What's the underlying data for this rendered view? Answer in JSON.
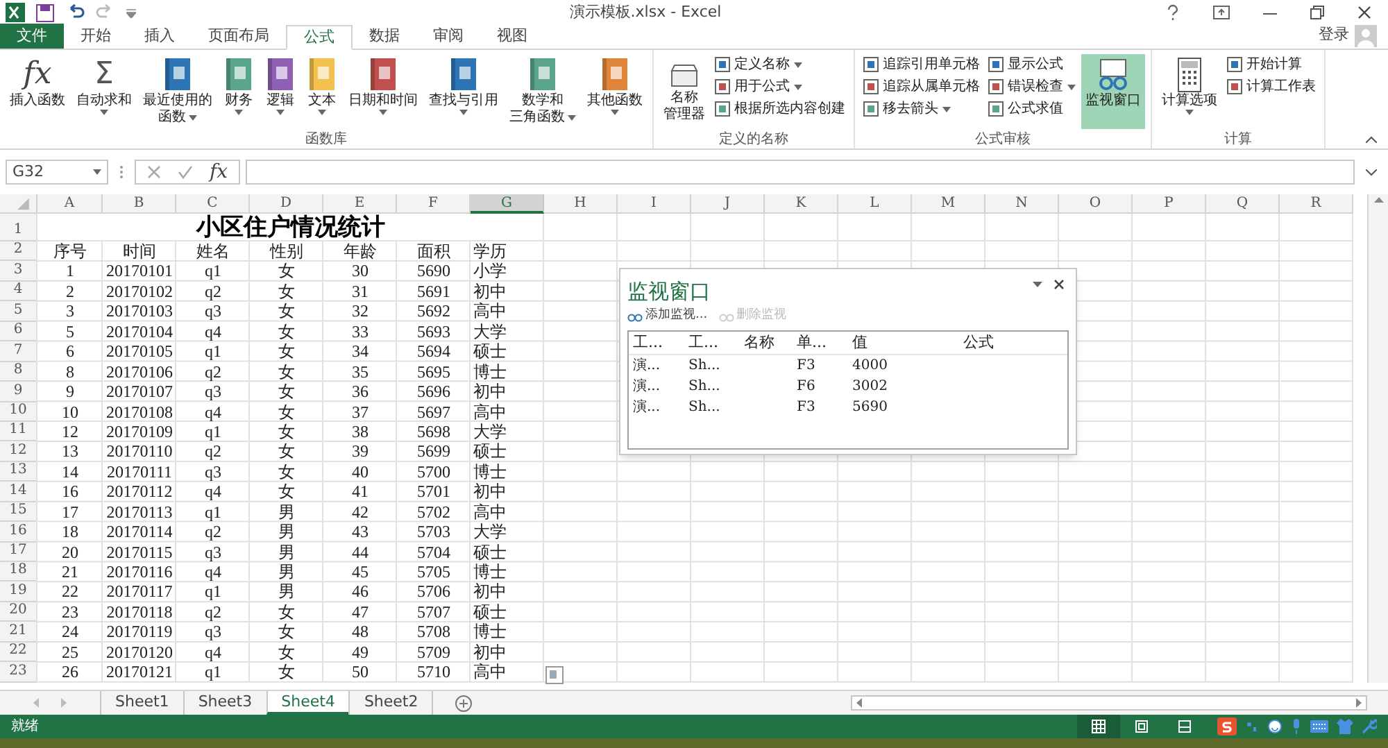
{
  "window": {
    "title": "演示模板.xlsx - Excel",
    "signin": "登录"
  },
  "tabs": [
    {
      "label": "文件",
      "kind": "file",
      "selected": false
    },
    {
      "label": "开始",
      "kind": "tab",
      "selected": false
    },
    {
      "label": "插入",
      "kind": "tab",
      "selected": false
    },
    {
      "label": "页面布局",
      "kind": "tab",
      "selected": false
    },
    {
      "label": "公式",
      "kind": "tab",
      "selected": true
    },
    {
      "label": "数据",
      "kind": "tab",
      "selected": false
    },
    {
      "label": "审阅",
      "kind": "tab",
      "selected": false
    },
    {
      "label": "视图",
      "kind": "tab",
      "selected": false
    }
  ],
  "ribbon_groups": [
    {
      "label": "函数库",
      "items": [
        {
          "kind": "large",
          "lines": [
            "插入函数"
          ],
          "glyph": "fx",
          "dropdown": false,
          "selected": false
        },
        {
          "kind": "large",
          "lines": [
            "自动求和"
          ],
          "glyph": "Σ",
          "dropdown": true,
          "selected": false
        },
        {
          "kind": "large",
          "lines": [
            "最近使用的",
            "函数"
          ],
          "dropdown": true,
          "selected": false
        },
        {
          "kind": "large",
          "lines": [
            "财务"
          ],
          "dropdown": true,
          "selected": false
        },
        {
          "kind": "large",
          "lines": [
            "逻辑"
          ],
          "dropdown": true,
          "selected": false
        },
        {
          "kind": "large",
          "lines": [
            "文本"
          ],
          "dropdown": true,
          "selected": false
        },
        {
          "kind": "large",
          "lines": [
            "日期和时间"
          ],
          "dropdown": true,
          "selected": false
        },
        {
          "kind": "large",
          "lines": [
            "查找与引用"
          ],
          "dropdown": true,
          "selected": false
        },
        {
          "kind": "large",
          "lines": [
            "数学和",
            "三角函数"
          ],
          "dropdown": true,
          "selected": false
        },
        {
          "kind": "large",
          "lines": [
            "其他函数"
          ],
          "dropdown": true,
          "selected": false
        }
      ]
    },
    {
      "label": "定义的名称",
      "items": [
        {
          "kind": "large",
          "lines": [
            "名称",
            "管理器"
          ],
          "dropdown": false,
          "selected": false
        },
        {
          "kind": "stack",
          "buttons": [
            {
              "label": "定义名称",
              "dropdown": true
            },
            {
              "label": "用于公式",
              "dropdown": true
            },
            {
              "label": "根据所选内容创建",
              "dropdown": false
            }
          ]
        }
      ]
    },
    {
      "label": "公式审核",
      "items": [
        {
          "kind": "stack",
          "buttons": [
            {
              "label": "追踪引用单元格",
              "dropdown": false
            },
            {
              "label": "追踪从属单元格",
              "dropdown": false
            },
            {
              "label": "移去箭头",
              "dropdown": true
            }
          ]
        },
        {
          "kind": "stack",
          "buttons": [
            {
              "label": "显示公式",
              "dropdown": false
            },
            {
              "label": "错误检查",
              "dropdown": true
            },
            {
              "label": "公式求值",
              "dropdown": false
            }
          ]
        },
        {
          "kind": "large",
          "lines": [
            "监视窗口"
          ],
          "dropdown": false,
          "selected": true
        }
      ]
    },
    {
      "label": "计算",
      "items": [
        {
          "kind": "large",
          "lines": [
            "计算选项"
          ],
          "dropdown": true,
          "selected": false
        },
        {
          "kind": "stack",
          "buttons": [
            {
              "label": "开始计算",
              "dropdown": false
            },
            {
              "label": "计算工作表",
              "dropdown": false
            }
          ]
        }
      ]
    }
  ],
  "formula_bar": {
    "name_box": "G32",
    "function_button": "fx"
  },
  "sheet": {
    "columns": [
      {
        "label": "A",
        "selected": false
      },
      {
        "label": "B",
        "selected": false
      },
      {
        "label": "C",
        "selected": false
      },
      {
        "label": "D",
        "selected": false
      },
      {
        "label": "E",
        "selected": false
      },
      {
        "label": "F",
        "selected": false
      },
      {
        "label": "G",
        "selected": true
      },
      {
        "label": "H",
        "selected": false
      },
      {
        "label": "I",
        "selected": false
      },
      {
        "label": "J",
        "selected": false
      },
      {
        "label": "K",
        "selected": false
      },
      {
        "label": "L",
        "selected": false
      },
      {
        "label": "M",
        "selected": false
      },
      {
        "label": "N",
        "selected": false
      },
      {
        "label": "O",
        "selected": false
      },
      {
        "label": "P",
        "selected": false
      },
      {
        "label": "Q",
        "selected": false
      },
      {
        "label": "R",
        "selected": false
      }
    ],
    "title_row": {
      "header": "1",
      "title": "小区住户情况统计",
      "colspan": 7
    },
    "rows": [
      {
        "header": "2",
        "cells": [
          "序号",
          "时间",
          "姓名",
          "性别",
          "年龄",
          "面积",
          "学历"
        ]
      },
      {
        "header": "3",
        "cells": [
          "1",
          "20170101",
          "q1",
          "女",
          "30",
          "5690",
          "小学"
        ]
      },
      {
        "header": "4",
        "cells": [
          "2",
          "20170102",
          "q2",
          "女",
          "31",
          "5691",
          "初中"
        ]
      },
      {
        "header": "5",
        "cells": [
          "3",
          "20170103",
          "q3",
          "女",
          "32",
          "5692",
          "高中"
        ]
      },
      {
        "header": "6",
        "cells": [
          "5",
          "20170104",
          "q4",
          "女",
          "33",
          "5693",
          "大学"
        ]
      },
      {
        "header": "7",
        "cells": [
          "6",
          "20170105",
          "q1",
          "女",
          "34",
          "5694",
          "硕士"
        ]
      },
      {
        "header": "8",
        "cells": [
          "8",
          "20170106",
          "q2",
          "女",
          "35",
          "5695",
          "博士"
        ]
      },
      {
        "header": "9",
        "cells": [
          "9",
          "20170107",
          "q3",
          "女",
          "36",
          "5696",
          "初中"
        ]
      },
      {
        "header": "10",
        "cells": [
          "10",
          "20170108",
          "q4",
          "女",
          "37",
          "5697",
          "高中"
        ]
      },
      {
        "header": "11",
        "cells": [
          "12",
          "20170109",
          "q1",
          "女",
          "38",
          "5698",
          "大学"
        ]
      },
      {
        "header": "12",
        "cells": [
          "13",
          "20170110",
          "q2",
          "女",
          "39",
          "5699",
          "硕士"
        ]
      },
      {
        "header": "13",
        "cells": [
          "14",
          "20170111",
          "q3",
          "女",
          "40",
          "5700",
          "博士"
        ]
      },
      {
        "header": "14",
        "cells": [
          "16",
          "20170112",
          "q4",
          "女",
          "41",
          "5701",
          "初中"
        ]
      },
      {
        "header": "15",
        "cells": [
          "17",
          "20170113",
          "q1",
          "男",
          "42",
          "5702",
          "高中"
        ]
      },
      {
        "header": "16",
        "cells": [
          "18",
          "20170114",
          "q2",
          "男",
          "43",
          "5703",
          "大学"
        ]
      },
      {
        "header": "17",
        "cells": [
          "20",
          "20170115",
          "q3",
          "男",
          "44",
          "5704",
          "硕士"
        ]
      },
      {
        "header": "18",
        "cells": [
          "21",
          "20170116",
          "q4",
          "男",
          "45",
          "5705",
          "博士"
        ]
      },
      {
        "header": "19",
        "cells": [
          "22",
          "20170117",
          "q1",
          "男",
          "46",
          "5706",
          "初中"
        ]
      },
      {
        "header": "20",
        "cells": [
          "23",
          "20170118",
          "q2",
          "女",
          "47",
          "5707",
          "硕士"
        ]
      },
      {
        "header": "21",
        "cells": [
          "24",
          "20170119",
          "q3",
          "女",
          "48",
          "5708",
          "博士"
        ]
      },
      {
        "header": "22",
        "cells": [
          "25",
          "20170120",
          "q4",
          "女",
          "49",
          "5709",
          "初中"
        ]
      },
      {
        "header": "23",
        "cells": [
          "26",
          "20170121",
          "q1",
          "女",
          "50",
          "5710",
          "高中"
        ]
      }
    ]
  },
  "watch_window": {
    "title": "监视窗口",
    "toolbar": [
      {
        "label": "添加监视...",
        "disabled": false
      },
      {
        "label": "删除监视",
        "disabled": true
      }
    ],
    "columns": [
      "工...",
      "工...",
      "名称",
      "单...",
      "值",
      "公式"
    ],
    "rows": [
      {
        "workbook": "演...",
        "sheet": "Sh...",
        "cell": "F3",
        "value": "4000"
      },
      {
        "workbook": "演...",
        "sheet": "Sh...",
        "cell": "F6",
        "value": "3002"
      },
      {
        "workbook": "演...",
        "sheet": "Sh...",
        "cell": "F3",
        "value": "5690"
      }
    ]
  },
  "sheet_tabs": [
    {
      "label": "Sheet1",
      "selected": false
    },
    {
      "label": "Sheet3",
      "selected": false
    },
    {
      "label": "Sheet4",
      "selected": true
    },
    {
      "label": "Sheet2",
      "selected": false
    }
  ],
  "status_bar": {
    "text": "就绪",
    "views": [
      {
        "kind": "normal",
        "selected": true
      },
      {
        "kind": "layout",
        "selected": false
      },
      {
        "kind": "pagebreak",
        "selected": false
      }
    ]
  }
}
